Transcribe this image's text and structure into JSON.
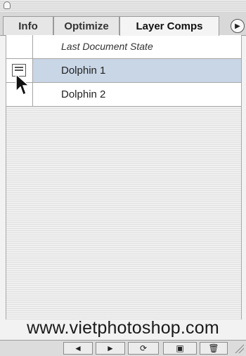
{
  "tabs": [
    {
      "label": "Info"
    },
    {
      "label": "Optimize"
    },
    {
      "label": "Layer Comps"
    }
  ],
  "active_tab": "Layer Comps",
  "rows": [
    {
      "label": "Last Document State",
      "style": "italic",
      "selected": false
    },
    {
      "label": "Dolphin 1",
      "style": "normal",
      "selected": true
    },
    {
      "label": "Dolphin 2",
      "style": "normal",
      "selected": false
    }
  ],
  "watermark": "www.vietphotoshop.com",
  "bottom_toolbar": {
    "prev_icon": "◄",
    "next_icon": "►",
    "update_icon": "⟳",
    "new_icon": "▣",
    "delete_icon": "🗑"
  },
  "colors": {
    "selected_row": "#c9d6e6",
    "panel_bg": "#f2f2f2"
  }
}
